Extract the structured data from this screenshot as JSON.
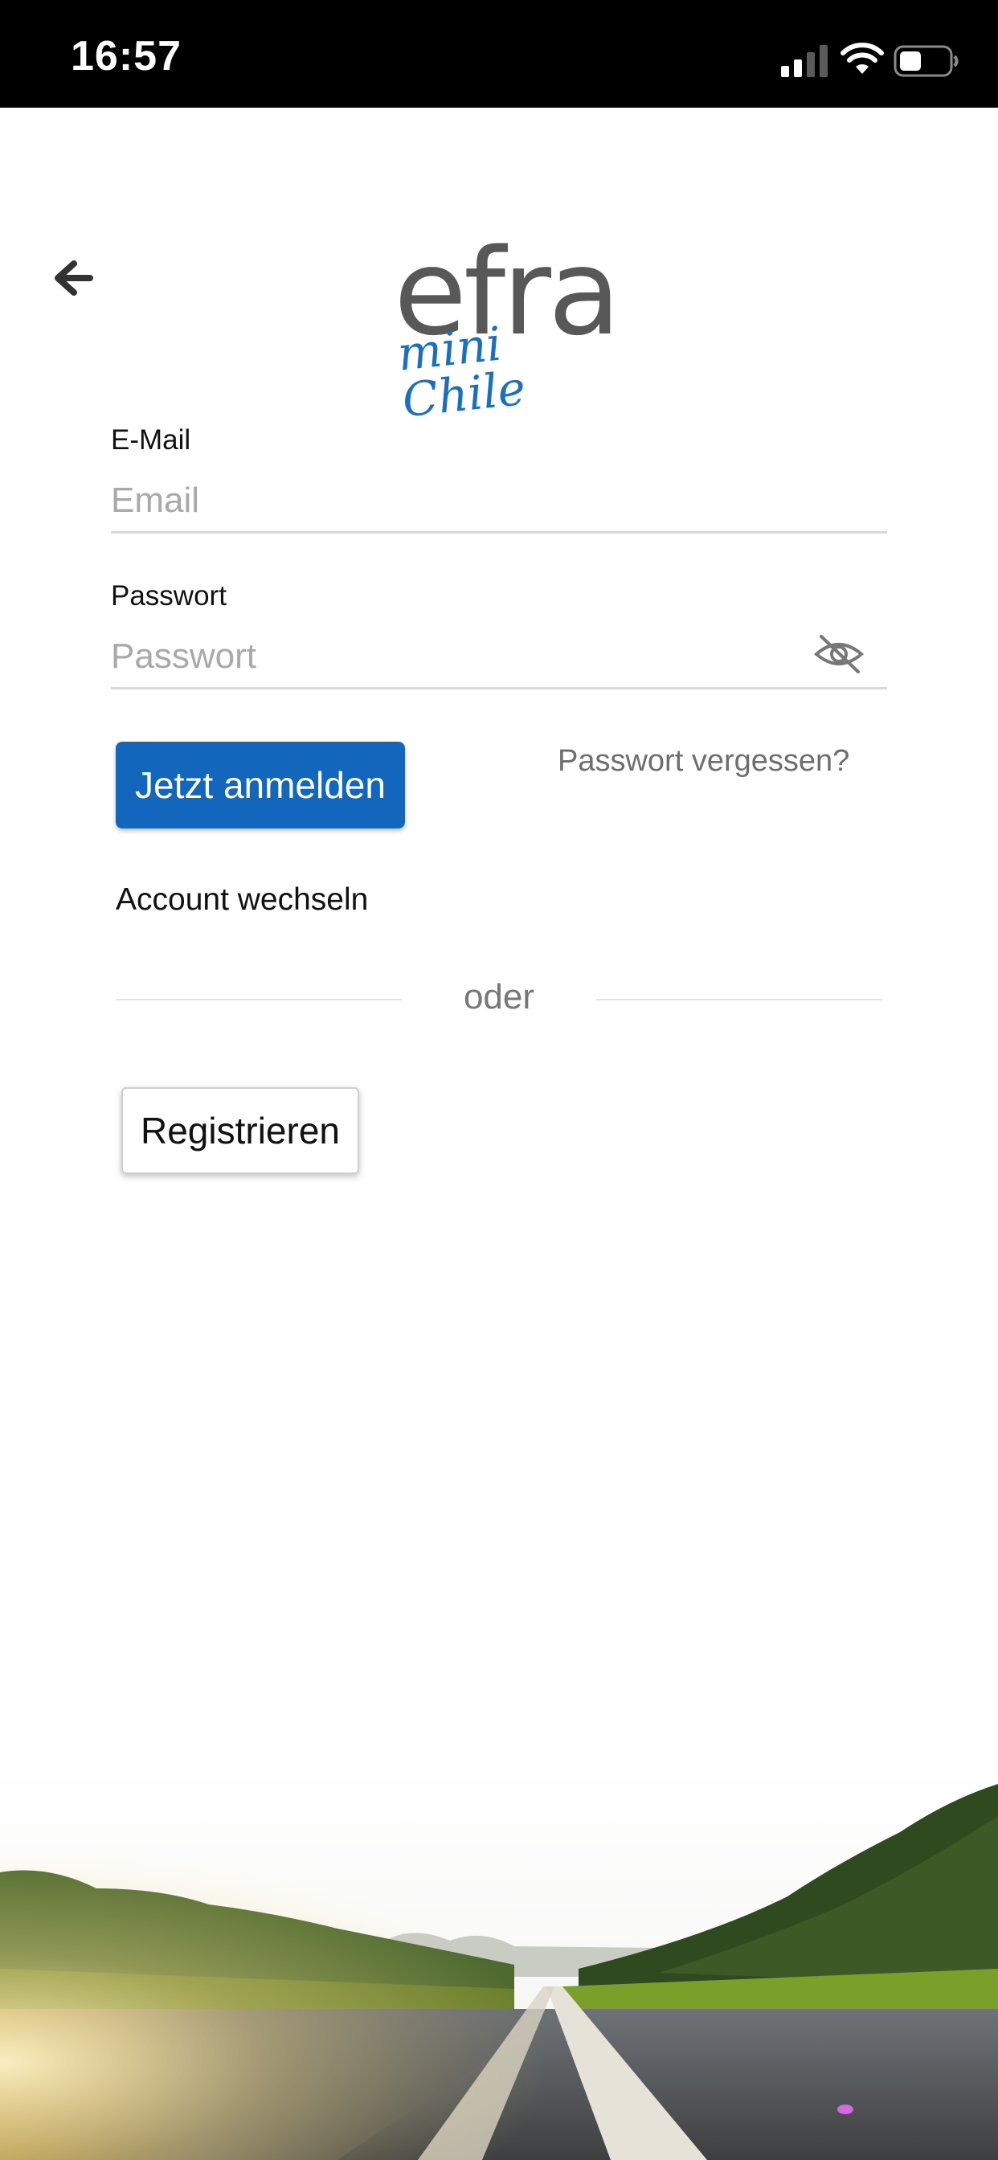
{
  "status_bar": {
    "time": "16:57",
    "icons": [
      "cellular-signal-icon",
      "wifi-icon",
      "battery-icon"
    ]
  },
  "header": {
    "back_icon": "arrow-left-icon",
    "logo": {
      "word": "efra",
      "sub": "mini Chile",
      "brand_color": "#1a6fc0",
      "word_color": "#585858"
    }
  },
  "form": {
    "email": {
      "label": "E-Mail",
      "placeholder": "Email",
      "value": ""
    },
    "password": {
      "label": "Passwort",
      "placeholder": "Passwort",
      "value": "",
      "visibility_icon": "eye-off-icon"
    },
    "submit_label": "Jetzt anmelden",
    "forgot_label": "Passwort vergessen?",
    "switch_account_label": "Account wechseln",
    "divider_text": "oder",
    "register_label": "Registrieren"
  },
  "colors": {
    "primary": "#1267bd",
    "placeholder": "#a9a9a9",
    "divider": "#e5e5e5"
  },
  "background": {
    "image": "road-landscape"
  }
}
